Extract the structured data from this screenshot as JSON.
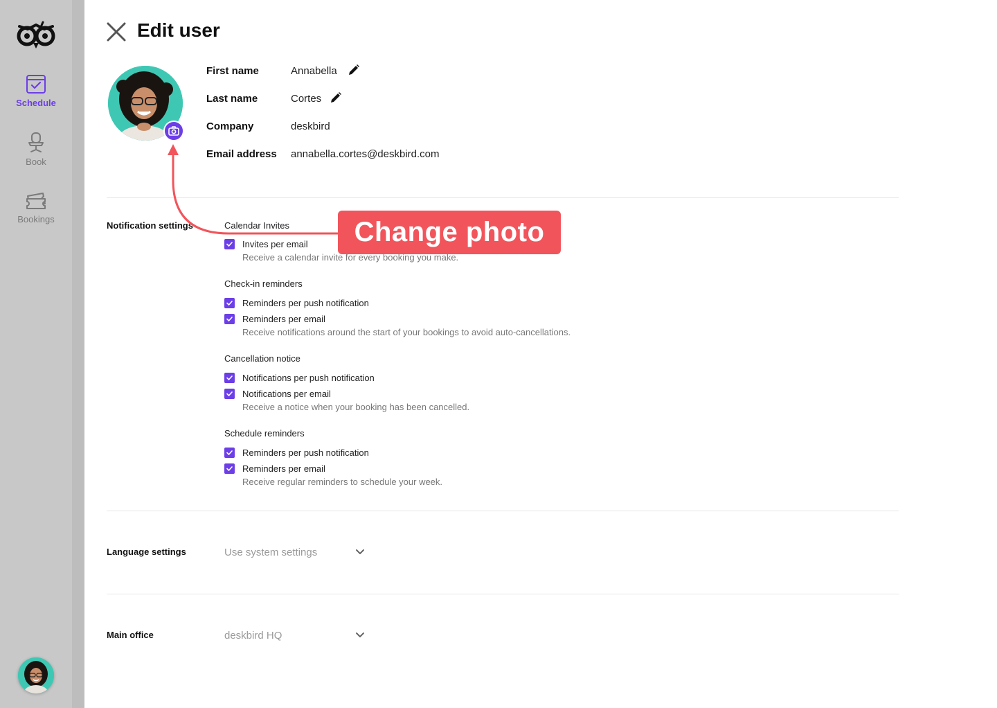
{
  "sidebar": {
    "items": [
      {
        "label": "Schedule",
        "icon": "calendar-check-icon",
        "active": true
      },
      {
        "label": "Book",
        "icon": "office-chair-icon",
        "active": false
      },
      {
        "label": "Bookings",
        "icon": "tickets-icon",
        "active": false
      }
    ]
  },
  "header": {
    "title": "Edit user"
  },
  "profile": {
    "fields": [
      {
        "label": "First name",
        "value": "Annabella",
        "editable": true
      },
      {
        "label": "Last name",
        "value": "Cortes",
        "editable": true
      },
      {
        "label": "Company",
        "value": "deskbird",
        "editable": false
      },
      {
        "label": "Email address",
        "value": "annabella.cortes@deskbird.com",
        "editable": false
      }
    ]
  },
  "notifications": {
    "section_label": "Notification settings",
    "groups": [
      {
        "title": "Calendar Invites",
        "options": [
          {
            "label": "Invites per email",
            "checked": true
          }
        ],
        "hint": "Receive a calendar invite for every booking you make."
      },
      {
        "title": "Check-in reminders",
        "options": [
          {
            "label": "Reminders per push notification",
            "checked": true
          },
          {
            "label": "Reminders per email",
            "checked": true
          }
        ],
        "hint": "Receive notifications around the start of your bookings to avoid auto-cancellations."
      },
      {
        "title": "Cancellation notice",
        "options": [
          {
            "label": "Notifications per push notification",
            "checked": true
          },
          {
            "label": "Notifications per email",
            "checked": true
          }
        ],
        "hint": "Receive a notice when your booking has been cancelled."
      },
      {
        "title": "Schedule reminders",
        "options": [
          {
            "label": "Reminders per push notification",
            "checked": true
          },
          {
            "label": "Reminders per email",
            "checked": true
          }
        ],
        "hint": "Receive regular reminders to schedule your week."
      }
    ]
  },
  "language": {
    "section_label": "Language settings",
    "value": "Use system settings"
  },
  "office": {
    "section_label": "Main office",
    "value": "deskbird HQ"
  },
  "annotation": {
    "text": "Change photo",
    "color": "#f2545b"
  },
  "colors": {
    "accent": "#6c3ee8",
    "sidebar": "#c8c8c8",
    "avatar_bg": "#3ec8b4"
  }
}
